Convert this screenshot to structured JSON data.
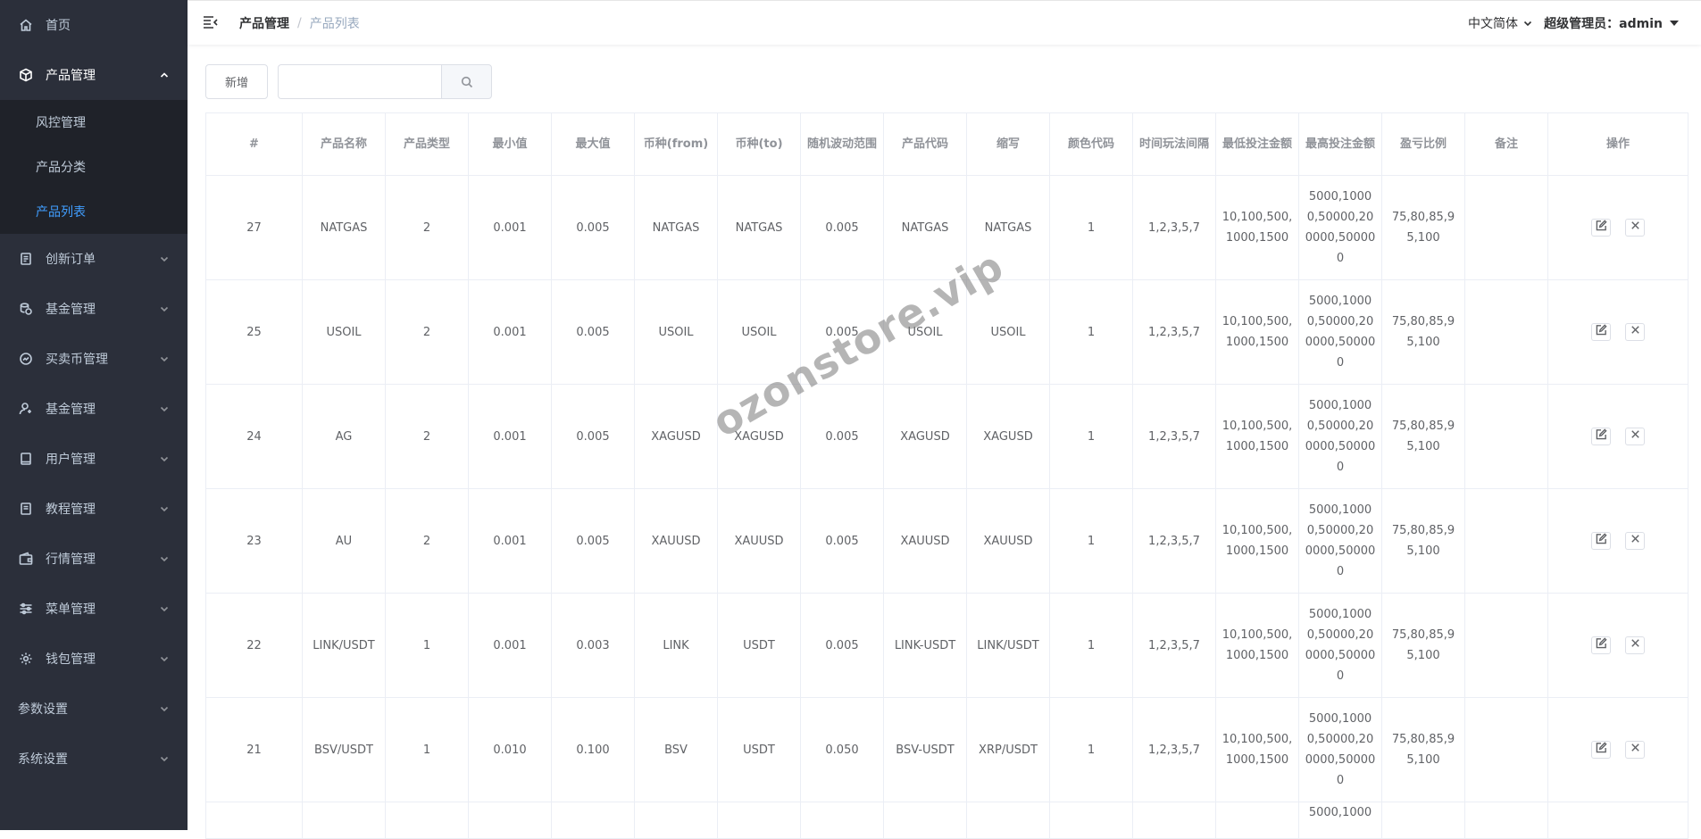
{
  "sidebar": {
    "items": [
      {
        "label": "首页",
        "icon": "home-icon"
      },
      {
        "label": "产品管理",
        "icon": "box-icon",
        "expanded": true,
        "children": [
          "风控管理",
          "产品分类",
          "产品列表"
        ],
        "active_child": 2
      },
      {
        "label": "创新订单",
        "icon": "order-icon"
      },
      {
        "label": "基金管理",
        "icon": "fund-icon"
      },
      {
        "label": "买卖币管理",
        "icon": "trade-icon"
      },
      {
        "label": "基金管理",
        "icon": "user-fund-icon"
      },
      {
        "label": "用户管理",
        "icon": "user-icon"
      },
      {
        "label": "教程管理",
        "icon": "book-icon"
      },
      {
        "label": "行情管理",
        "icon": "wallet-icon"
      },
      {
        "label": "菜单管理",
        "icon": "sliders-icon"
      },
      {
        "label": "钱包管理",
        "icon": "gear-icon"
      },
      {
        "label": "参数设置",
        "icon": ""
      },
      {
        "label": "系统设置",
        "icon": ""
      }
    ]
  },
  "header": {
    "breadcrumb": [
      "产品管理",
      "产品列表"
    ],
    "breadcrumb_sep": "/",
    "language": "中文简体",
    "user": "超级管理员：admin"
  },
  "toolbar": {
    "add_label": "新增",
    "search_value": "",
    "search_placeholder": ""
  },
  "table": {
    "columns": [
      "#",
      "产品名称",
      "产品类型",
      "最小值",
      "最大值",
      "币种(from)",
      "币种(to)",
      "随机波动范围",
      "产品代码",
      "缩写",
      "颜色代码",
      "时间玩法间隔",
      "最低投注金额",
      "最高投注金额",
      "盈亏比例",
      "备注",
      "操作"
    ],
    "rows": [
      [
        "27",
        "NATGAS",
        "2",
        "0.001",
        "0.005",
        "NATGAS",
        "NATGAS",
        "0.005",
        "NATGAS",
        "NATGAS",
        "1",
        "1,2,3,5,7",
        "10,100,500,1000,1500",
        "5000,10000,50000,200000,500000",
        "75,80,85,95,100",
        ""
      ],
      [
        "25",
        "USOIL",
        "2",
        "0.001",
        "0.005",
        "USOIL",
        "USOIL",
        "0.005",
        "USOIL",
        "USOIL",
        "1",
        "1,2,3,5,7",
        "10,100,500,1000,1500",
        "5000,10000,50000,200000,500000",
        "75,80,85,95,100",
        ""
      ],
      [
        "24",
        "AG",
        "2",
        "0.001",
        "0.005",
        "XAGUSD",
        "XAGUSD",
        "0.005",
        "XAGUSD",
        "XAGUSD",
        "1",
        "1,2,3,5,7",
        "10,100,500,1000,1500",
        "5000,10000,50000,200000,500000",
        "75,80,85,95,100",
        ""
      ],
      [
        "23",
        "AU",
        "2",
        "0.001",
        "0.005",
        "XAUUSD",
        "XAUUSD",
        "0.005",
        "XAUUSD",
        "XAUUSD",
        "1",
        "1,2,3,5,7",
        "10,100,500,1000,1500",
        "5000,10000,50000,200000,500000",
        "75,80,85,95,100",
        ""
      ],
      [
        "22",
        "LINK/USDT",
        "1",
        "0.001",
        "0.003",
        "LINK",
        "USDT",
        "0.005",
        "LINK-USDT",
        "LINK/USDT",
        "1",
        "1,2,3,5,7",
        "10,100,500,1000,1500",
        "5000,10000,50000,200000,500000",
        "75,80,85,95,100",
        ""
      ],
      [
        "21",
        "BSV/USDT",
        "1",
        "0.010",
        "0.100",
        "BSV",
        "USDT",
        "0.050",
        "BSV-USDT",
        "XRP/USDT",
        "1",
        "1,2,3,5,7",
        "10,100,500,1000,1500",
        "5000,10000,50000,200000,500000",
        "75,80,85,95,100",
        ""
      ]
    ],
    "partial_row": [
      "",
      "",
      "",
      "",
      "",
      "",
      "",
      "",
      "",
      "",
      "",
      "",
      "",
      "5000,1000",
      "",
      ""
    ]
  },
  "watermark": "ozonstore.vip",
  "colors": {
    "sidebar_bg": "#2b2f3a",
    "submenu_bg": "#1f2229",
    "active_link": "#409eff",
    "border": "#ebeef5"
  }
}
